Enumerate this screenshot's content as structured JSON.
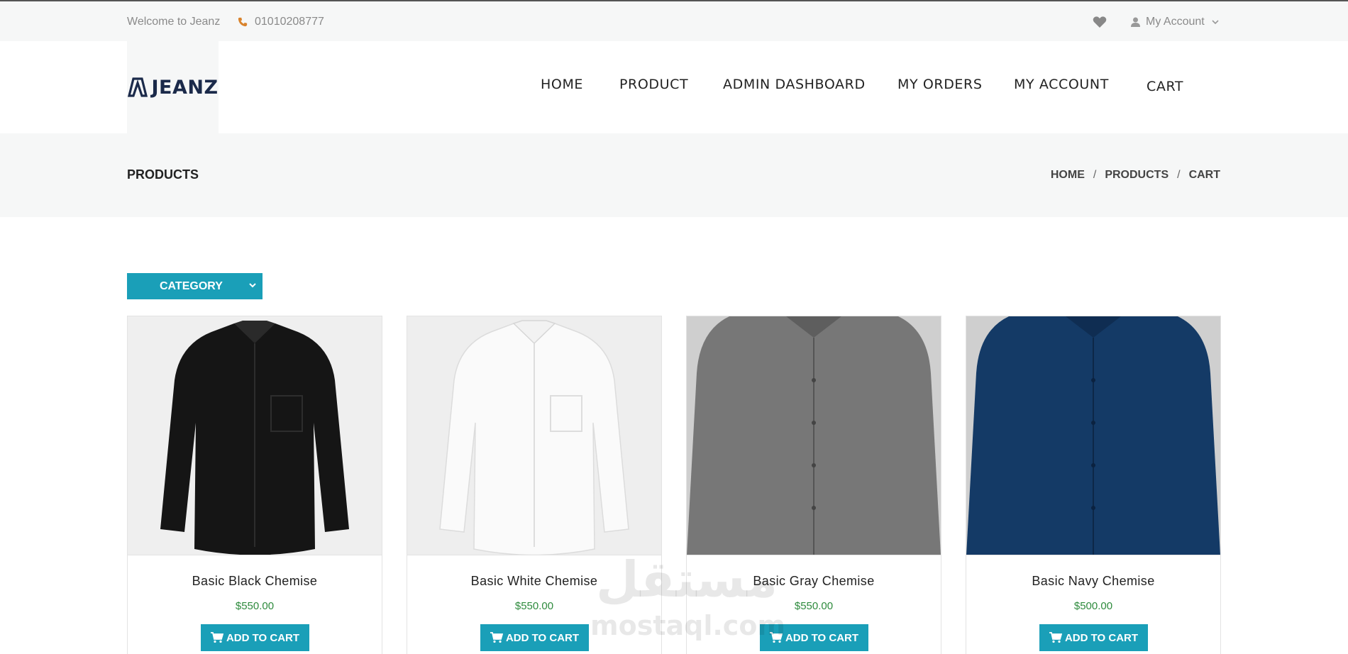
{
  "topbar": {
    "welcome": "Welcome to Jeanz",
    "phone": "01010208777",
    "account_label": "My Account"
  },
  "header": {
    "logo_text": "JEANZ",
    "nav": [
      "HOME",
      "PRODUCT",
      "ADMIN DASHBOARD",
      "MY ORDERS",
      "MY ACCOUNT",
      "CART"
    ]
  },
  "page": {
    "title": "PRODUCTS",
    "breadcrumb": [
      "HOME",
      "PRODUCTS",
      "CART"
    ],
    "breadcrumb_sep": "/"
  },
  "filter": {
    "category_label": "CATEGORY"
  },
  "products": [
    {
      "name": "Basic Black Chemise",
      "price": "$550.00",
      "button": "ADD TO CART",
      "color": "#151515"
    },
    {
      "name": "Basic White Chemise",
      "price": "$550.00",
      "button": "ADD TO CART",
      "color": "#fafafa"
    },
    {
      "name": "Basic Gray Chemise",
      "price": "$550.00",
      "button": "ADD TO CART",
      "color": "#777777"
    },
    {
      "name": "Basic Navy Chemise",
      "price": "$500.00",
      "button": "ADD TO CART",
      "color": "#143a66"
    }
  ],
  "watermark": {
    "arabic": "مستقل",
    "latin": "mostaql.com"
  },
  "colors": {
    "accent": "#1a9fb8",
    "price": "#2e8b3d",
    "band": "#f6f7f7"
  }
}
